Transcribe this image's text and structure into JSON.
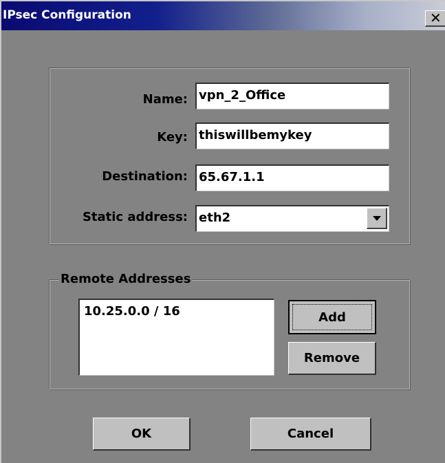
{
  "window": {
    "title": "IPsec Configuration",
    "close_glyph": "✕"
  },
  "fields": {
    "name_label": "Name:",
    "name_value": "vpn_2_Office",
    "key_label": "Key:",
    "key_value": "thiswillbemykey",
    "destination_label": "Destination:",
    "destination_value": "65.67.1.1",
    "static_label": "Static address:",
    "static_value": "eth2"
  },
  "remote": {
    "legend": "Remote Addresses",
    "items": [
      "10.25.0.0 / 16"
    ],
    "add_label": "Add",
    "remove_label": "Remove"
  },
  "footer": {
    "ok_label": "OK",
    "cancel_label": "Cancel"
  }
}
